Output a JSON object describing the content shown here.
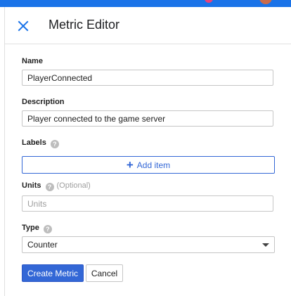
{
  "header": {
    "title": "Metric Editor",
    "close_icon": "close-icon"
  },
  "form": {
    "name": {
      "label": "Name",
      "value": "PlayerConnected"
    },
    "description": {
      "label": "Description",
      "value": "Player connected to the game server"
    },
    "labels": {
      "label": "Labels",
      "add_item_label": "Add item",
      "add_icon": "plus-icon"
    },
    "units": {
      "label": "Units",
      "optional": "(Optional)",
      "placeholder": "Units"
    },
    "type": {
      "label": "Type",
      "selected": "Counter"
    }
  },
  "actions": {
    "create": "Create Metric",
    "cancel": "Cancel"
  },
  "colors": {
    "accent": "#3367d6",
    "topbar": "#1a73e8"
  }
}
